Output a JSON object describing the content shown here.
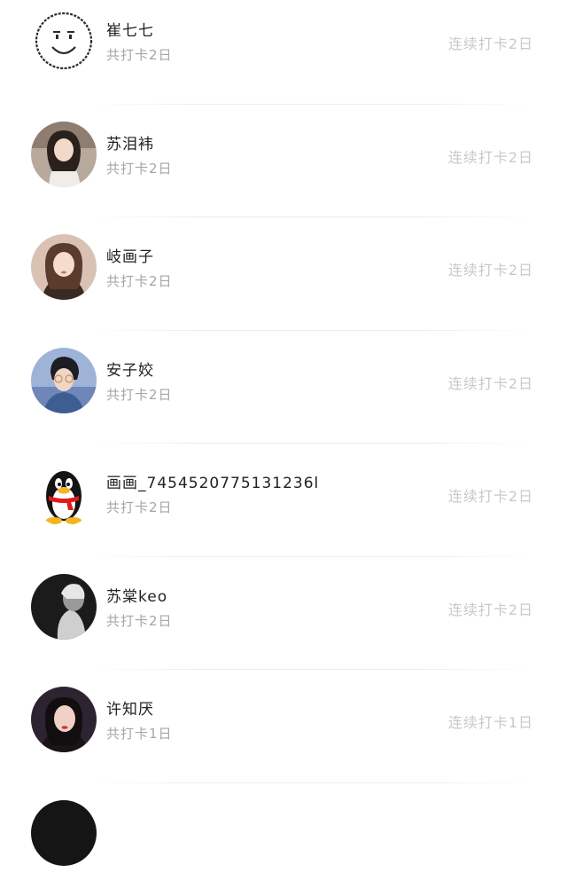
{
  "checkin_list": [
    {
      "name": "崔七七",
      "total": "共打卡2日",
      "streak": "连续打卡2日",
      "avatar_icon": "smiley-face-sketch"
    },
    {
      "name": "苏泪袆",
      "total": "共打卡2日",
      "streak": "连续打卡2日",
      "avatar_icon": "girl-photo"
    },
    {
      "name": "岐画子",
      "total": "共打卡2日",
      "streak": "连续打卡2日",
      "avatar_icon": "girl-photo"
    },
    {
      "name": "安子姣",
      "total": "共打卡2日",
      "streak": "连续打卡2日",
      "avatar_icon": "boy-photo"
    },
    {
      "name": "画画_7454520775131236l",
      "total": "共打卡2日",
      "streak": "连续打卡2日",
      "avatar_icon": "qq-penguin"
    },
    {
      "name": "苏棠keo",
      "total": "共打卡2日",
      "streak": "连续打卡2日",
      "avatar_icon": "dark-portrait-photo"
    },
    {
      "name": "许知厌",
      "total": "共打卡1日",
      "streak": "连续打卡1日",
      "avatar_icon": "girl-photo"
    }
  ],
  "colors": {
    "name_text": "#222222",
    "secondary_text": "#a6a6a6",
    "streak_text": "#c9c9c9",
    "divider": "#ececec",
    "penguin_scarf": "#e01b1b",
    "penguin_beak": "#f6b51e"
  }
}
